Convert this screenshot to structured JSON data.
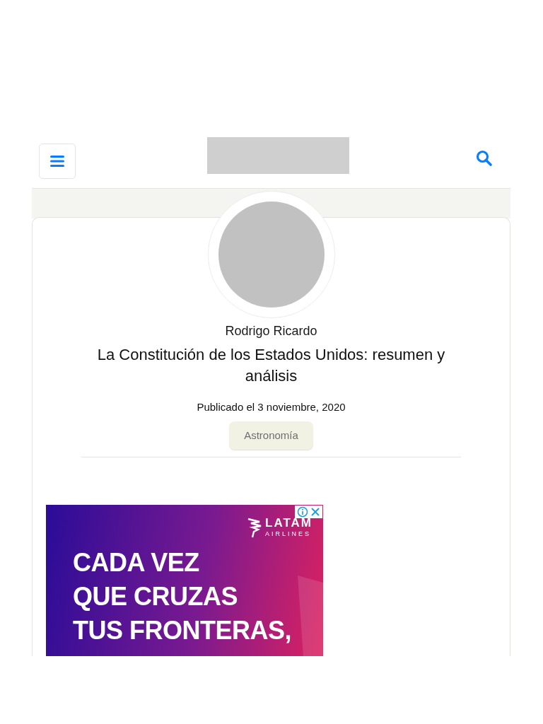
{
  "header": {
    "logo": {
      "kind": "placeholder"
    }
  },
  "article": {
    "author": "Rodrigo Ricardo",
    "title": "La Constitución de los Estados Unidos: resumen y análisis",
    "date": "Publicado el 3 noviembre, 2020",
    "category": "Astronomía"
  },
  "ad": {
    "brand": "LATAM",
    "brand_sub": "AIRLINES",
    "lines": [
      "CADA VEZ",
      "QUE CRUZAS",
      "TUS FRONTERAS,"
    ]
  }
}
